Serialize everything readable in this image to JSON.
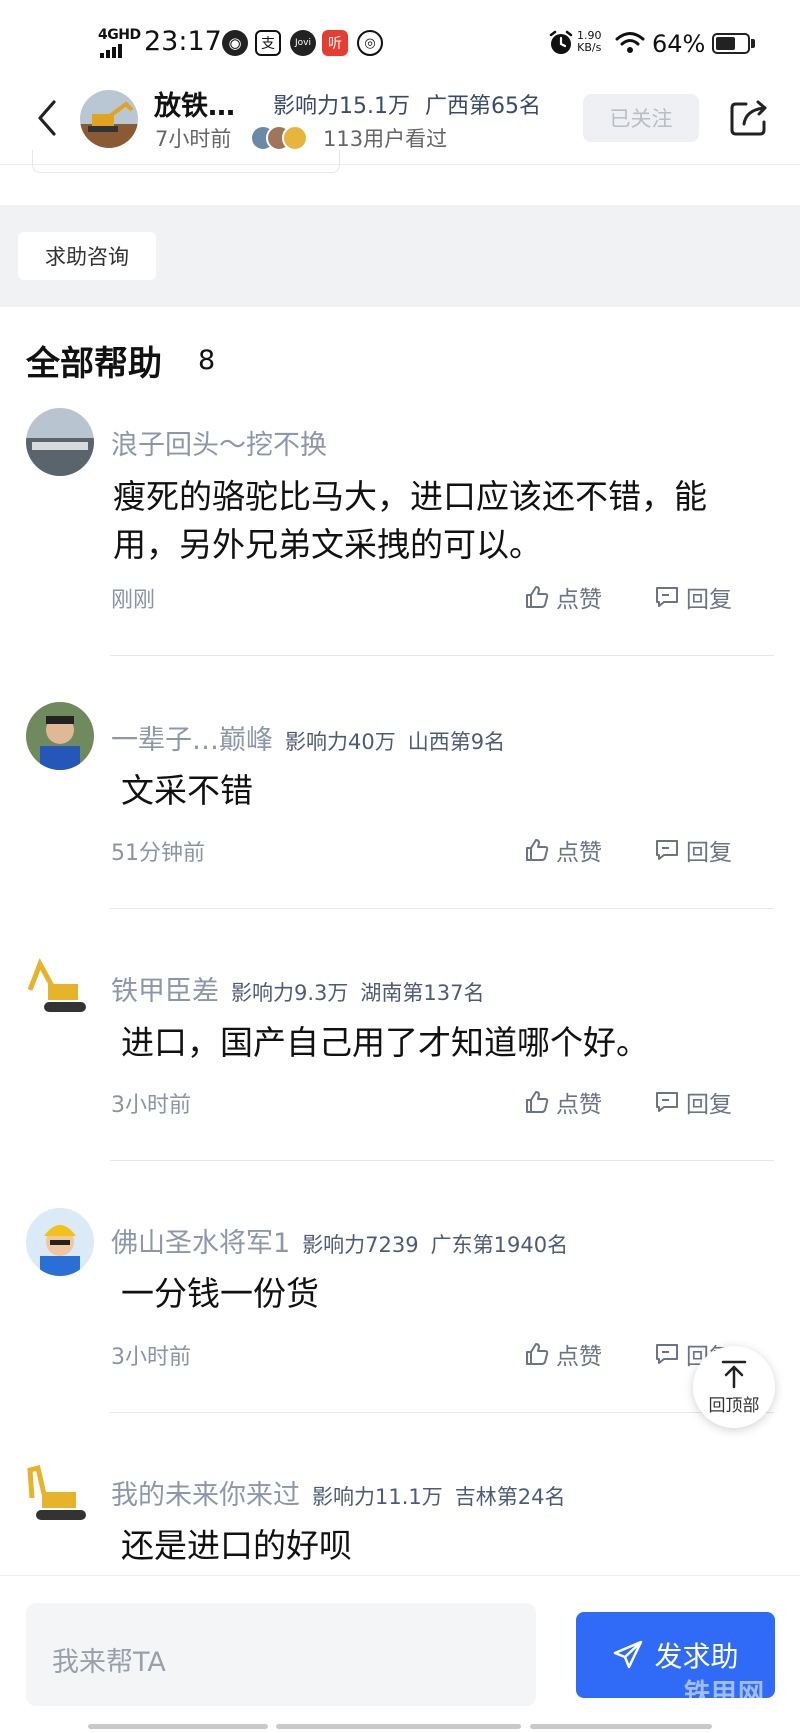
{
  "status_bar": {
    "network": "4GHD",
    "time": "23:17",
    "app_icons": [
      "browser-icon",
      "alipay-icon",
      "jovi-icon",
      "ting-icon",
      "netease-music-icon"
    ],
    "speed_value": "1.90",
    "speed_unit": "KB/s",
    "battery_percent": "64%",
    "battery_level": 0.64
  },
  "header": {
    "name": "放铁…",
    "influence": "影响力15.1万",
    "rank": "广西第65名",
    "time": "7小时前",
    "viewers": "113用户看过",
    "follow_label": "已关注"
  },
  "tag": {
    "label": "求助咨询"
  },
  "section": {
    "title": "全部帮助",
    "count": "8"
  },
  "comments": [
    {
      "name": "浪子回头～挖不换",
      "influence": "",
      "rank": "",
      "text": "瘦死的骆驼比马大，进口应该还不错，能用，另外兄弟文采拽的可以。",
      "time": "刚刚",
      "like": "点赞",
      "reply": "回复"
    },
    {
      "name": "一辈子…巅峰",
      "influence": "影响力40万",
      "rank": "山西第9名",
      "text": "文采不错",
      "time": "51分钟前",
      "like": "点赞",
      "reply": "回复"
    },
    {
      "name": "铁甲臣差",
      "influence": "影响力9.3万",
      "rank": "湖南第137名",
      "text": "进口，国产自己用了才知道哪个好。",
      "time": "3小时前",
      "like": "点赞",
      "reply": "回复"
    },
    {
      "name": "佛山圣水将军1",
      "influence": "影响力7239",
      "rank": "广东第1940名",
      "text": "一分钱一份货",
      "time": "3小时前",
      "like": "点赞",
      "reply": "回复"
    },
    {
      "name": "我的未来你来过",
      "influence": "影响力11.1万",
      "rank": "吉林第24名",
      "text": "还是进口的好呗",
      "time": "",
      "like": "",
      "reply": ""
    }
  ],
  "back_to_top": {
    "label": "回顶部"
  },
  "bottom": {
    "input_placeholder": "我来帮TA",
    "send_label": "发求助",
    "watermark": "铁甲网"
  },
  "colors": {
    "accent": "#2f6bf6",
    "username": "#8d97aa",
    "meta": "#4e5b78",
    "band": "#f1f2f4"
  }
}
